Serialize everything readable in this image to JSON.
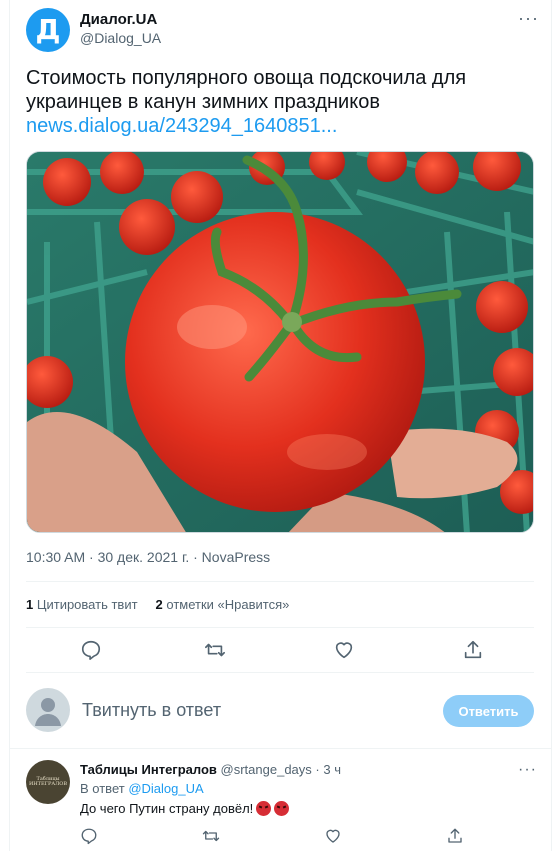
{
  "tweet": {
    "author_name": "Диалог.UA",
    "author_handle": "@Dialog_UA",
    "avatar_letter": "Д",
    "more": "···",
    "text": "Стоимость популярного овоща подскочила для украинцев в канун зимних праздников",
    "link": "news.dialog.ua/243294_1640851...",
    "meta": "10:30 AM · 30 дек. 2021 г. · NovaPress",
    "stats": {
      "quote_count": "1",
      "quote_label": "Цитировать твит",
      "like_count": "2",
      "like_label": "отметки «Нравится»"
    },
    "actions": [
      "reply-icon",
      "retweet-icon",
      "like-icon",
      "share-icon"
    ]
  },
  "composer": {
    "placeholder": "Твитнуть в ответ",
    "button_label": "Ответить"
  },
  "reply": {
    "author_name": "Таблицы Интегралов",
    "author_handle": "@srtange_days",
    "time": "· 3 ч",
    "more": "···",
    "replying_prefix": "В ответ",
    "replying_to": "@Dialog_UA",
    "text": "До чего Путин страну довёл!",
    "emojis": [
      "angry-face-emoji",
      "angry-face-emoji"
    ],
    "avatar_text": "Таблицы ИНТЕГРАЛОВ"
  },
  "colors": {
    "accent": "#1d9bf0",
    "button_disabled": "#8ecdf8",
    "secondary_text": "#536471"
  }
}
